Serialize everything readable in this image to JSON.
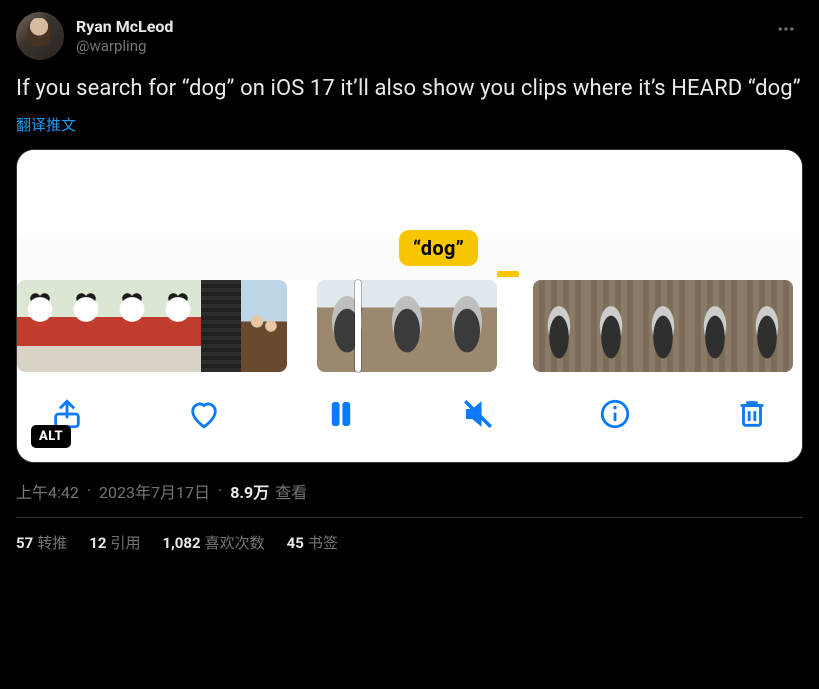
{
  "author": {
    "display_name": "Ryan McLeod",
    "handle": "@warpling"
  },
  "tweet_text": "If you search for “dog” on iOS 17 it’ll also show you clips where it’s HEARD “dog”",
  "translate_label": "翻译推文",
  "media": {
    "bubble_text": "“dog”",
    "alt_badge": "ALT",
    "toolbar": {
      "share": "share-icon",
      "like": "heart-icon",
      "pause": "pause-icon",
      "mute": "speaker-muted-icon",
      "info": "info-icon",
      "delete": "trash-icon"
    }
  },
  "meta": {
    "time": "上午4:42",
    "date": "2023年7月17日",
    "views_number": "8.9万",
    "views_label": "查看"
  },
  "stats": {
    "retweets": {
      "count": "57",
      "label": "转推"
    },
    "quotes": {
      "count": "12",
      "label": "引用"
    },
    "likes": {
      "count": "1,082",
      "label": "喜欢次数"
    },
    "bookmarks": {
      "count": "45",
      "label": "书签"
    }
  }
}
